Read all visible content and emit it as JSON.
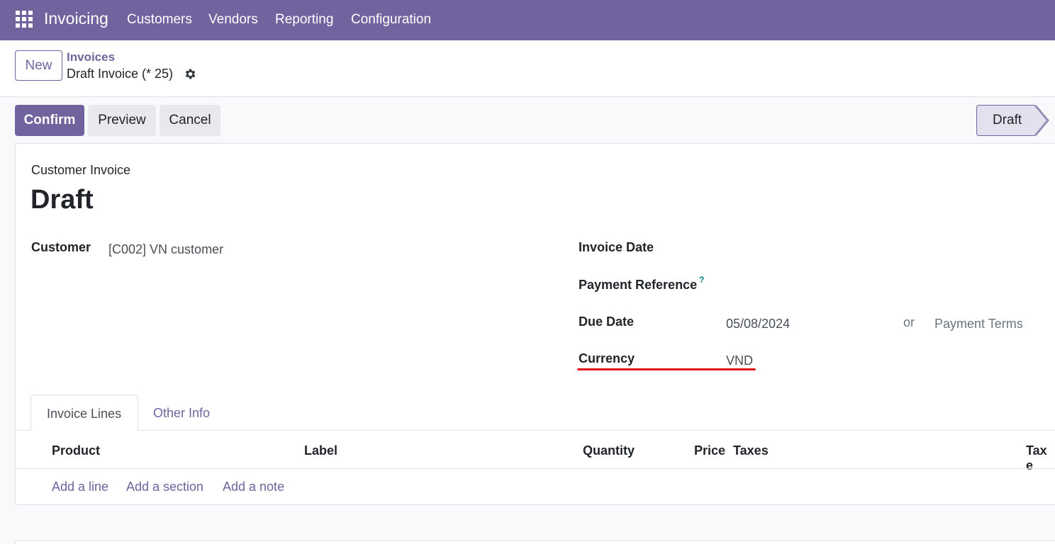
{
  "navbar": {
    "app_name": "Invoicing",
    "menu": [
      "Customers",
      "Vendors",
      "Reporting",
      "Configuration"
    ],
    "color": "#71639e"
  },
  "control_panel": {
    "new_label": "New",
    "breadcrumb_parent": "Invoices",
    "breadcrumb_current": "Draft Invoice (* 25)"
  },
  "statusbar": {
    "confirm_label": "Confirm",
    "preview_label": "Preview",
    "cancel_label": "Cancel",
    "stage_label": "Draft"
  },
  "form": {
    "doc_type": "Customer Invoice",
    "title": "Draft",
    "customer_label": "Customer",
    "customer_value": "[C002] VN customer",
    "invoice_date_label": "Invoice Date",
    "payment_ref_label": "Payment Reference",
    "payment_ref_help": "?",
    "due_date_label": "Due Date",
    "due_date_value": "05/08/2024",
    "or_label": "or",
    "payment_terms_placeholder": "Payment Terms",
    "currency_label": "Currency",
    "currency_value": "VND",
    "highlight_color": "#e0151b"
  },
  "tabs": {
    "invoice_lines": "Invoice Lines",
    "other_info": "Other Info"
  },
  "lines_table": {
    "headers": {
      "product": "Product",
      "label": "Label",
      "quantity": "Quantity",
      "price": "Price",
      "taxes": "Taxes",
      "tax_excl": "Tax e"
    },
    "add_line": "Add a line",
    "add_section": "Add a section",
    "add_note": "Add a note"
  }
}
